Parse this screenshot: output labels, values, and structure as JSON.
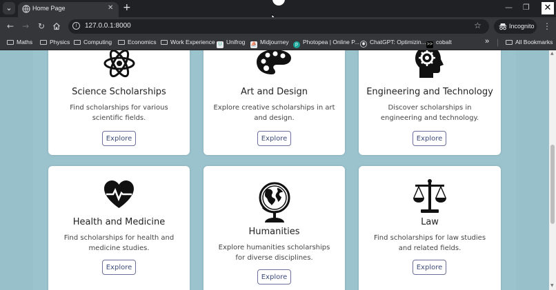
{
  "browser": {
    "tab_title": "Home Page",
    "url": "127.0.0.1:8000",
    "incognito_label": "Incognito",
    "new_tab_symbol": "+",
    "tab_close_symbol": "✕"
  },
  "bookmarks": {
    "items": [
      {
        "label": "Maths",
        "icon": "folder-icon"
      },
      {
        "label": "Physics",
        "icon": "folder-icon"
      },
      {
        "label": "Computing",
        "icon": "folder-icon"
      },
      {
        "label": "Economics",
        "icon": "folder-icon"
      },
      {
        "label": "Work Experience",
        "icon": "folder-icon"
      },
      {
        "label": "Unifrog",
        "icon": "unifrog-icon"
      },
      {
        "label": "Midjourney",
        "icon": "midjourney-icon"
      },
      {
        "label": "Photopea | Online P...",
        "icon": "photopea-icon"
      },
      {
        "label": "ChatGPT: Optimizin...",
        "icon": "chatgpt-icon"
      },
      {
        "label": "cobalt",
        "icon": "cobalt-icon"
      }
    ],
    "overflow": "»",
    "all_bookmarks": "All Bookmarks"
  },
  "cards": [
    {
      "title": "Science Scholarships",
      "description": "Find scholarships for various scientific fields.",
      "button": "Explore",
      "icon": "atom-icon"
    },
    {
      "title": "Art and Design",
      "description": "Explore creative scholarships in art and design.",
      "button": "Explore",
      "icon": "palette-icon"
    },
    {
      "title": "Engineering and Technology",
      "description": "Discover scholarships in engineering and technology.",
      "button": "Explore",
      "icon": "gear-head-icon"
    },
    {
      "title": "Health and Medicine",
      "description": "Find scholarships for health and medicine studies.",
      "button": "Explore",
      "icon": "heartbeat-icon"
    },
    {
      "title": "Humanities",
      "description": "Explore humanities scholarships for diverse disciplines.",
      "button": "Explore",
      "icon": "globe-icon"
    },
    {
      "title": "Law",
      "description": "Find scholarships for law studies and related fields.",
      "button": "Explore",
      "icon": "scales-icon"
    }
  ]
}
